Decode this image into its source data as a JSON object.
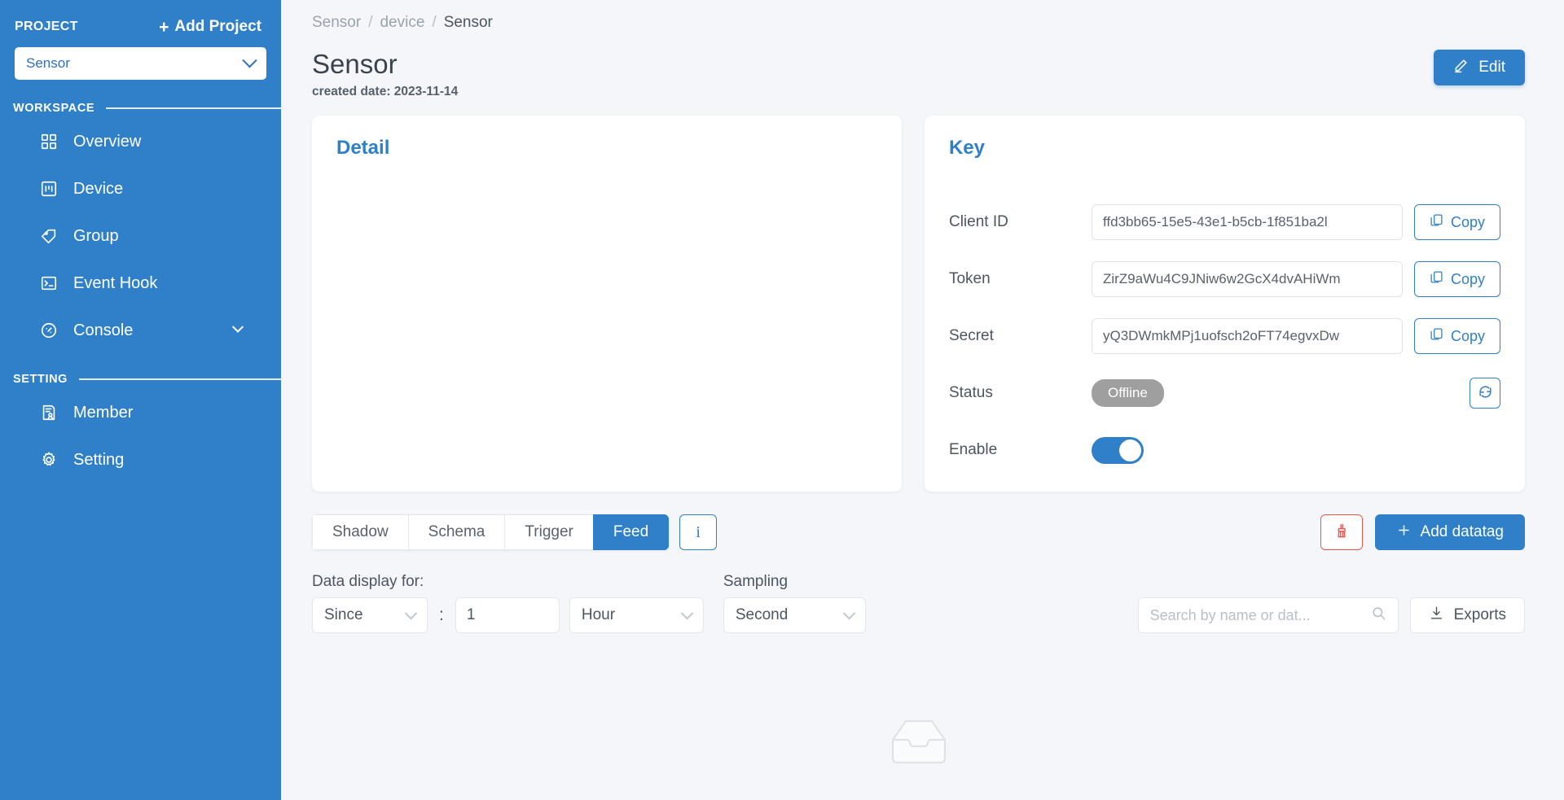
{
  "sidebar": {
    "project_label": "PROJECT",
    "add_project_label": "Add Project",
    "add_project_icon": "plus-icon",
    "project_selected": "Sensor",
    "project_dropdown_icon": "chevron-down-icon",
    "workspace_label": "WORKSPACE",
    "setting_label": "SETTING",
    "workspace_items": [
      {
        "label": "Overview",
        "icon": "grid-icon"
      },
      {
        "label": "Device",
        "icon": "device-board-icon"
      },
      {
        "label": "Group",
        "icon": "tag-icon"
      },
      {
        "label": "Event Hook",
        "icon": "terminal-icon"
      },
      {
        "label": "Console",
        "icon": "gauge-icon",
        "expandable": true,
        "expand_icon": "chevron-down-icon"
      }
    ],
    "setting_items": [
      {
        "label": "Member",
        "icon": "member-list-icon"
      },
      {
        "label": "Setting",
        "icon": "gear-icon"
      }
    ],
    "bg_color": "#2f80c8"
  },
  "breadcrumb": [
    {
      "label": "Sensor",
      "current": false
    },
    {
      "label": "device",
      "current": false
    },
    {
      "label": "Sensor",
      "current": true
    }
  ],
  "breadcrumb_separator": "/",
  "header": {
    "title": "Sensor",
    "subtitle": "created date: 2023-11-14",
    "edit_label": "Edit",
    "edit_icon": "pencil-icon"
  },
  "detail_card": {
    "title": "Detail"
  },
  "key_card": {
    "title": "Key",
    "rows": [
      {
        "label": "Client ID",
        "value": "ffd3bb65-15e5-43e1-b5cb-1f851ba2l",
        "copy_label": "Copy",
        "copy_icon": "copy-icon"
      },
      {
        "label": "Token",
        "value": "ZirZ9aWu4C9JNiw6w2GcX4dvAHiWm",
        "copy_label": "Copy",
        "copy_icon": "copy-icon"
      },
      {
        "label": "Secret",
        "value": "yQ3DWmkMPj1uofsch2oFT74egvxDw",
        "copy_label": "Copy",
        "copy_icon": "copy-icon"
      }
    ],
    "status_label": "Status",
    "status_value": "Offline",
    "status_color": "#9f9f9f",
    "refresh_icon": "refresh-icon",
    "enable_label": "Enable",
    "enable_on": true
  },
  "tabs": [
    {
      "label": "Shadow",
      "active": false
    },
    {
      "label": "Schema",
      "active": false
    },
    {
      "label": "Trigger",
      "active": false
    },
    {
      "label": "Feed",
      "active": true
    }
  ],
  "info_button_label": "i",
  "toolbar": {
    "clear_icon": "broom-clear-icon",
    "add_datatag_label": "Add datatag",
    "add_icon": "plus-icon"
  },
  "filters": {
    "data_display_label": "Data display for:",
    "sampling_label": "Sampling",
    "range_mode": "Since",
    "colon": ":",
    "range_value": "1",
    "range_unit": "Hour",
    "sampling_value": "Second",
    "dropdown_icon": "chevron-down-icon"
  },
  "search": {
    "placeholder": "Search by name or dat...",
    "value": "",
    "icon": "search-icon"
  },
  "exports": {
    "label": "Exports",
    "icon": "download-icon"
  },
  "empty_state": {
    "icon": "empty-inbox-icon"
  },
  "colors": {
    "accent": "#2f80c8",
    "danger": "#e8554d",
    "page_bg": "#f4f6fa"
  }
}
